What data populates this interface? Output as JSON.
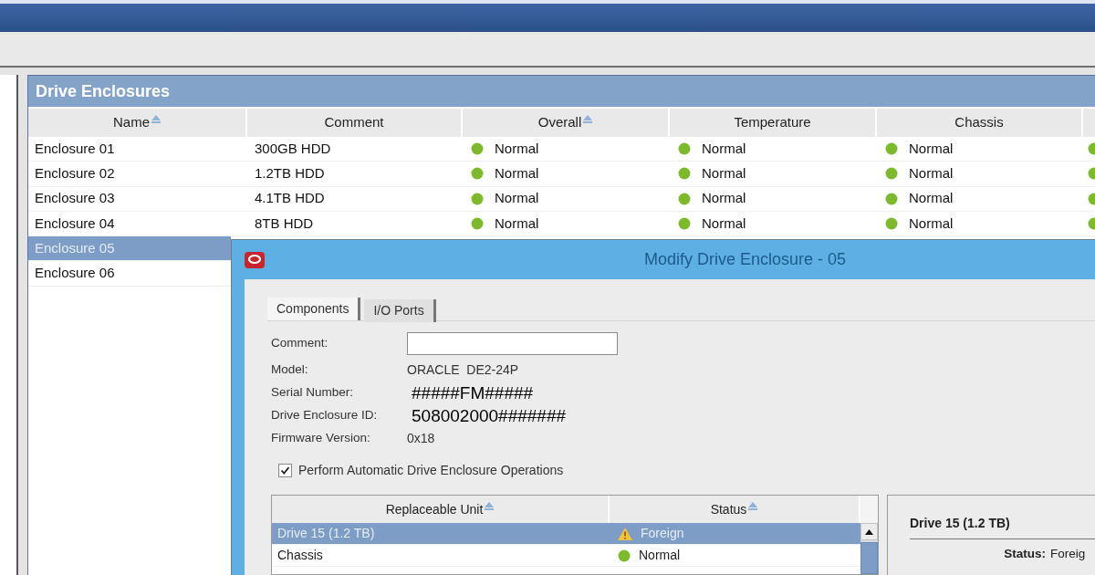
{
  "panel": {
    "title": "Drive Enclosures"
  },
  "table": {
    "columns": [
      {
        "label": "Name",
        "sorted": true
      },
      {
        "label": "Comment",
        "sorted": false
      },
      {
        "label": "Overall",
        "sorted": true
      },
      {
        "label": "Temperature",
        "sorted": false
      },
      {
        "label": "Chassis",
        "sorted": false
      }
    ],
    "rows": [
      {
        "name": "Enclosure 01",
        "comment": "300GB HDD",
        "statuses": [
          {
            "label": "Normal",
            "color": "#7cba2c"
          },
          {
            "label": "Normal",
            "color": "#7cba2c"
          },
          {
            "label": "Normal",
            "color": "#7cba2c"
          }
        ],
        "column_6": {
          "color": "#7cba2c"
        },
        "selected": false
      },
      {
        "name": "Enclosure 02",
        "comment": "1.2TB HDD",
        "statuses": [
          {
            "label": "Normal",
            "color": "#7cba2c"
          },
          {
            "label": "Normal",
            "color": "#7cba2c"
          },
          {
            "label": "Normal",
            "color": "#7cba2c"
          }
        ],
        "column_6": {
          "color": "#7cba2c"
        },
        "selected": false
      },
      {
        "name": "Enclosure 03",
        "comment": "4.1TB HDD",
        "statuses": [
          {
            "label": "Normal",
            "color": "#7cba2c"
          },
          {
            "label": "Normal",
            "color": "#7cba2c"
          },
          {
            "label": "Normal",
            "color": "#7cba2c"
          }
        ],
        "column_6": {
          "color": "#7cba2c"
        },
        "selected": false
      },
      {
        "name": "Enclosure 04",
        "comment": "8TB HDD",
        "statuses": [
          {
            "label": "Normal",
            "color": "#7cba2c"
          },
          {
            "label": "Normal",
            "color": "#7cba2c"
          },
          {
            "label": "Normal",
            "color": "#7cba2c"
          }
        ],
        "column_6": {
          "color": "#7cba2c"
        },
        "selected": false
      },
      {
        "name": "Enclosure 05",
        "selected": true
      },
      {
        "name": "Enclosure 06",
        "selected": false
      }
    ]
  },
  "dialog": {
    "title": "Modify Drive Enclosure - 05",
    "tabs": [
      {
        "label": "Components",
        "selected": true
      },
      {
        "label": "I/O Ports",
        "selected": false
      }
    ],
    "fields": [
      {
        "kind": "input",
        "label": "Comment:"
      },
      {
        "kind": "value",
        "label": "Model:",
        "value": "ORACLE  DE2-24P"
      },
      {
        "kind": "large_value",
        "label": "Serial Number:",
        "value": "#####FM#####"
      },
      {
        "kind": "large_value",
        "label": "Drive Enclosure ID:",
        "value": "508002000#######"
      },
      {
        "kind": "value",
        "label": "Firmware Version:",
        "value": "0x18"
      }
    ],
    "checkbox": {
      "label": "Perform Automatic Drive Enclosure Operations",
      "checked": true
    },
    "units_table": {
      "columns": [
        {
          "label": "Replaceable Unit",
          "sorted": true
        },
        {
          "label": "Status",
          "sorted": true
        }
      ],
      "rows": [
        {
          "unit": "Drive 15 (1.2 TB)",
          "status": {
            "kind": "warning",
            "label": "Foreign"
          },
          "selected": true
        },
        {
          "unit": "Chassis",
          "status": {
            "kind": "dot",
            "label": "Normal",
            "color": "#7cba2c"
          },
          "selected": false
        }
      ]
    },
    "detail": {
      "title": "Drive 15 (1.2 TB)",
      "fields": [
        {
          "label": "Status:",
          "value": "Foreig"
        }
      ]
    }
  }
}
